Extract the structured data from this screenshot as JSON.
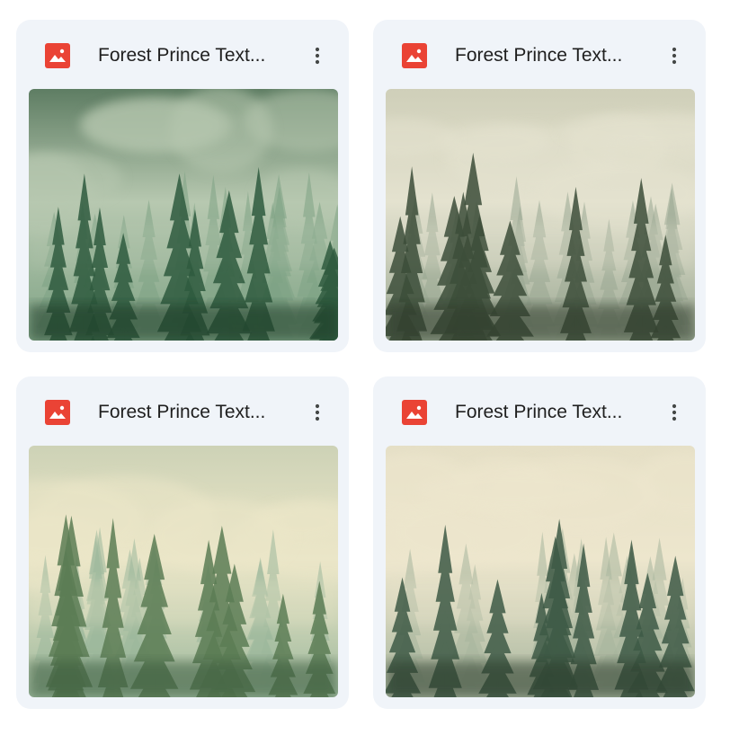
{
  "files": [
    {
      "title": "Forest Prince Text...",
      "icon": "image-icon",
      "icon_color": "#ea4335",
      "thumbnail": "misty dark-green pine forest painting",
      "palette": {
        "sky_top": "#5e7d63",
        "sky_mid": "#b7c8b0",
        "far": "#7fa385",
        "near": "#2f5b3f",
        "ground": "#1f3a28"
      }
    },
    {
      "title": "Forest Prince Text...",
      "icon": "image-icon",
      "icon_color": "#ea4335",
      "thumbnail": "foggy cream-sky pine forest painting",
      "palette": {
        "sky_top": "#cfcfb9",
        "sky_mid": "#e4e2cf",
        "far": "#9aa893",
        "near": "#3d4e3a",
        "ground": "#2f3a2a"
      }
    },
    {
      "title": "Forest Prince Text...",
      "icon": "image-icon",
      "icon_color": "#ea4335",
      "thumbnail": "pale green watercolor pine forest",
      "palette": {
        "sky_top": "#cdd2b6",
        "sky_mid": "#ebe6c8",
        "far": "#9cb89c",
        "near": "#5c7d55",
        "ground": "#3b5a3d"
      }
    },
    {
      "title": "Forest Prince Text...",
      "icon": "image-icon",
      "icon_color": "#ea4335",
      "thumbnail": "beige sky dark pine forest painting",
      "palette": {
        "sky_top": "#e5dfc6",
        "sky_mid": "#ede6cd",
        "far": "#a8b69e",
        "near": "#3e5a46",
        "ground": "#2a3a2c"
      }
    }
  ]
}
